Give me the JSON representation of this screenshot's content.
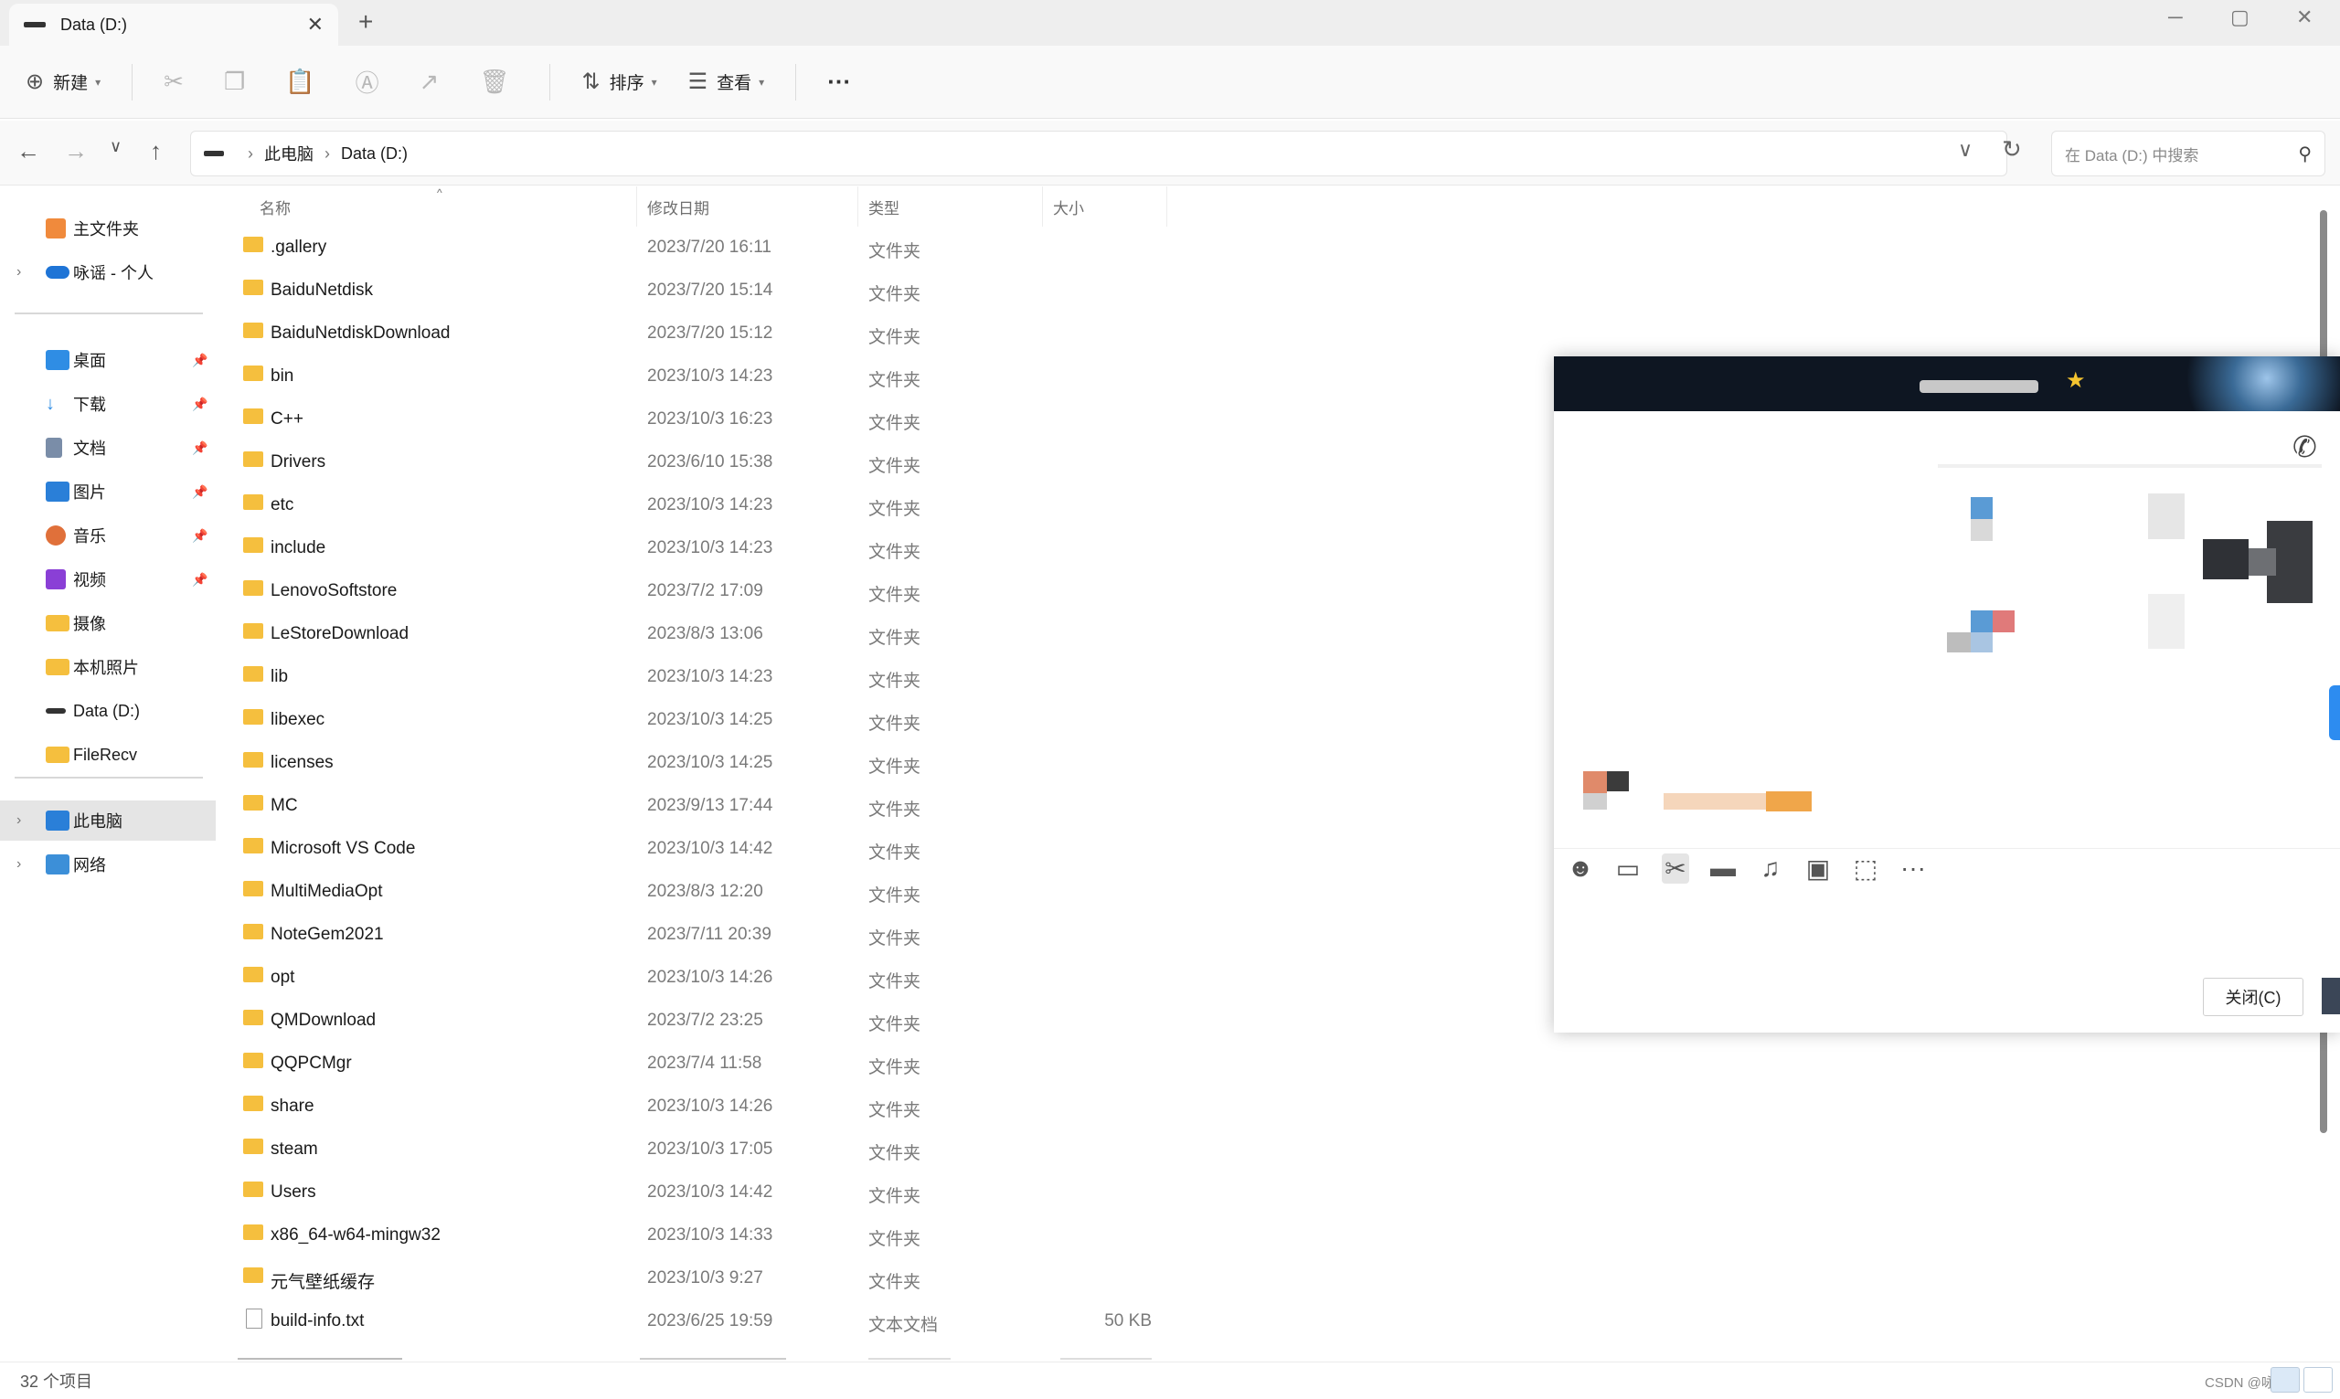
{
  "window": {
    "tab_title": "Data (D:)",
    "tab_close": "✕",
    "new_tab": "+",
    "controls": {
      "minimize": "─",
      "maximize": "▢",
      "close": "✕"
    }
  },
  "commandbar": {
    "new_label": "新建",
    "sort_label": "排序",
    "view_label": "查看",
    "more_label": "···"
  },
  "address": {
    "crumbs": [
      "此电脑",
      "Data (D:)"
    ],
    "search_placeholder": "在 Data (D:) 中搜索"
  },
  "sidebar": {
    "items": [
      {
        "label": "主文件夹",
        "icon": "home-icon"
      },
      {
        "label": "咏谣 - 个人",
        "icon": "onedrive-icon"
      },
      {
        "label": "桌面",
        "icon": "desktop-icon",
        "pinned": true
      },
      {
        "label": "下载",
        "icon": "download-icon",
        "pinned": true
      },
      {
        "label": "文档",
        "icon": "document-icon",
        "pinned": true
      },
      {
        "label": "图片",
        "icon": "pictures-icon",
        "pinned": true
      },
      {
        "label": "音乐",
        "icon": "music-icon",
        "pinned": true
      },
      {
        "label": "视频",
        "icon": "video-icon",
        "pinned": true
      },
      {
        "label": "摄像",
        "icon": "folder-icon"
      },
      {
        "label": "本机照片",
        "icon": "folder-icon"
      },
      {
        "label": "Data (D:)",
        "icon": "drive-icon"
      },
      {
        "label": "FileRecv",
        "icon": "folder-icon"
      },
      {
        "label": "此电脑",
        "icon": "computer-icon"
      },
      {
        "label": "网络",
        "icon": "network-icon"
      }
    ]
  },
  "columns": {
    "name": "名称",
    "modified": "修改日期",
    "type": "类型",
    "size": "大小"
  },
  "files": [
    {
      "name": ".gallery",
      "date": "2023/7/20 16:11",
      "type": "文件夹",
      "size": ""
    },
    {
      "name": "BaiduNetdisk",
      "date": "2023/7/20 15:14",
      "type": "文件夹",
      "size": ""
    },
    {
      "name": "BaiduNetdiskDownload",
      "date": "2023/7/20 15:12",
      "type": "文件夹",
      "size": ""
    },
    {
      "name": "bin",
      "date": "2023/10/3 14:23",
      "type": "文件夹",
      "size": ""
    },
    {
      "name": "C++",
      "date": "2023/10/3 16:23",
      "type": "文件夹",
      "size": ""
    },
    {
      "name": "Drivers",
      "date": "2023/6/10 15:38",
      "type": "文件夹",
      "size": ""
    },
    {
      "name": "etc",
      "date": "2023/10/3 14:23",
      "type": "文件夹",
      "size": ""
    },
    {
      "name": "include",
      "date": "2023/10/3 14:23",
      "type": "文件夹",
      "size": ""
    },
    {
      "name": "LenovoSoftstore",
      "date": "2023/7/2 17:09",
      "type": "文件夹",
      "size": ""
    },
    {
      "name": "LeStoreDownload",
      "date": "2023/8/3 13:06",
      "type": "文件夹",
      "size": ""
    },
    {
      "name": "lib",
      "date": "2023/10/3 14:23",
      "type": "文件夹",
      "size": ""
    },
    {
      "name": "libexec",
      "date": "2023/10/3 14:25",
      "type": "文件夹",
      "size": ""
    },
    {
      "name": "licenses",
      "date": "2023/10/3 14:25",
      "type": "文件夹",
      "size": ""
    },
    {
      "name": "MC",
      "date": "2023/9/13 17:44",
      "type": "文件夹",
      "size": ""
    },
    {
      "name": "Microsoft VS Code",
      "date": "2023/10/3 14:42",
      "type": "文件夹",
      "size": ""
    },
    {
      "name": "MultiMediaOpt",
      "date": "2023/8/3 12:20",
      "type": "文件夹",
      "size": ""
    },
    {
      "name": "NoteGem2021",
      "date": "2023/7/11 20:39",
      "type": "文件夹",
      "size": ""
    },
    {
      "name": "opt",
      "date": "2023/10/3 14:26",
      "type": "文件夹",
      "size": ""
    },
    {
      "name": "QMDownload",
      "date": "2023/7/2 23:25",
      "type": "文件夹",
      "size": ""
    },
    {
      "name": "QQPCMgr",
      "date": "2023/7/4 11:58",
      "type": "文件夹",
      "size": ""
    },
    {
      "name": "share",
      "date": "2023/10/3 14:26",
      "type": "文件夹",
      "size": ""
    },
    {
      "name": "steam",
      "date": "2023/10/3 17:05",
      "type": "文件夹",
      "size": ""
    },
    {
      "name": "Users",
      "date": "2023/10/3 14:42",
      "type": "文件夹",
      "size": ""
    },
    {
      "name": "x86_64-w64-mingw32",
      "date": "2023/10/3 14:33",
      "type": "文件夹",
      "size": ""
    },
    {
      "name": "元气壁纸缓存",
      "date": "2023/10/3 9:27",
      "type": "文件夹",
      "size": ""
    },
    {
      "name": "build-info.txt",
      "date": "2023/6/25 19:59",
      "type": "文本文档",
      "size": "50 KB",
      "kind": "txt"
    }
  ],
  "status": {
    "item_count": "32 个项目",
    "watermark": "CSDN @咏谣"
  },
  "chat": {
    "close_button": "关闭(C)",
    "toolbar_icons": [
      "emoji-icon",
      "gif-icon",
      "scissors-icon",
      "folder-icon",
      "music-icon",
      "image-icon",
      "screenshot-icon",
      "more-icon"
    ]
  },
  "colors": {
    "folder": "#f5bf3e",
    "accent": "#2d8cf0",
    "chat_header": "#0e1622"
  }
}
